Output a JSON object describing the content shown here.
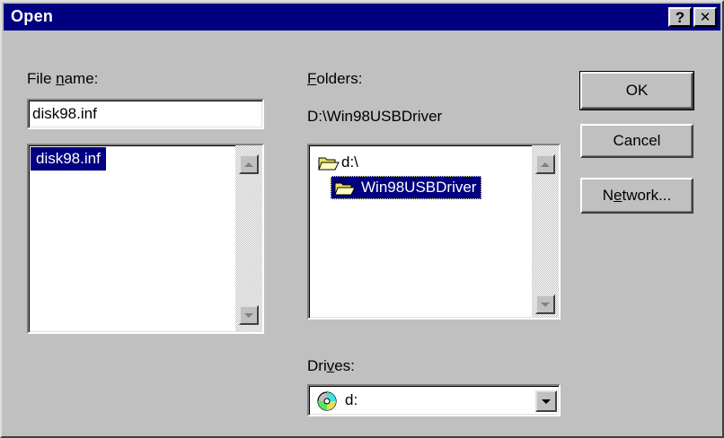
{
  "window": {
    "title": "Open",
    "help_glyph": "?",
    "close_glyph": "✕"
  },
  "file_name": {
    "label_pre": "File ",
    "label_key": "n",
    "label_post": "ame:",
    "value": "disk98.inf",
    "files": [
      "disk98.inf"
    ]
  },
  "folders": {
    "label_pre": "",
    "label_key": "F",
    "label_post": "olders:",
    "current_path": "D:\\Win98USBDriver",
    "items": [
      {
        "label": "d:\\",
        "icon": "open-folder-icon"
      },
      {
        "label": "Win98USBDriver",
        "icon": "open-folder-icon"
      }
    ]
  },
  "drives": {
    "label_pre": "Dri",
    "label_key": "v",
    "label_post": "es:",
    "selected": "d:",
    "icon": "cd-drive-icon"
  },
  "buttons": {
    "ok": "OK",
    "cancel": "Cancel",
    "network_pre": "N",
    "network_key": "e",
    "network_post": "twork..."
  },
  "colors": {
    "face": "#c0c0c0",
    "title_bar": "#000080",
    "selection": "#000080",
    "folder_yellow": "#f0e060"
  }
}
